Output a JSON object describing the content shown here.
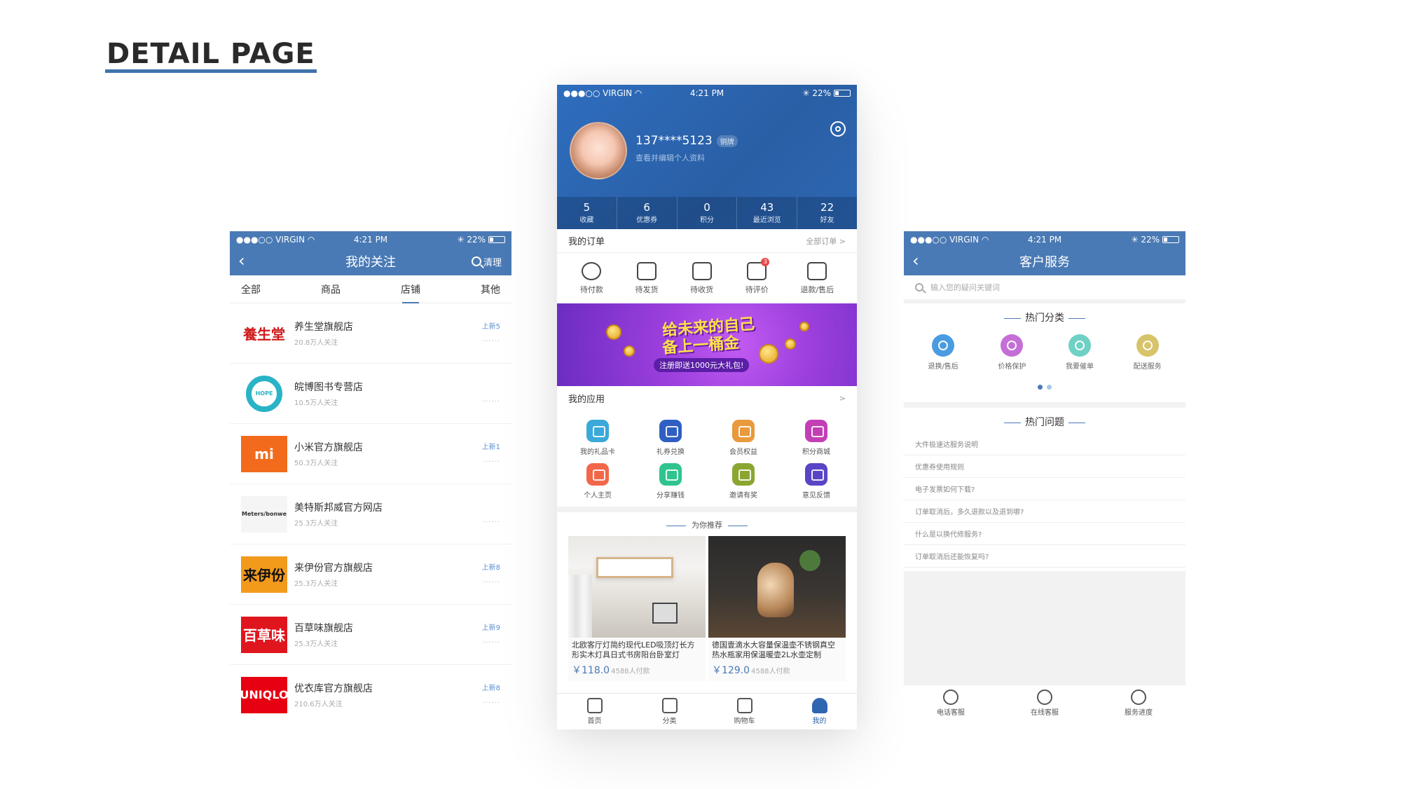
{
  "page_title": "DETAIL PAGE",
  "status": {
    "carrier": "●●●○○ VIRGIN",
    "wifi": "◠",
    "time": "4:21 PM",
    "bt": "✳",
    "battery": "22%"
  },
  "follow": {
    "title": "我的关注",
    "right": "清理",
    "tabs": [
      "全部",
      "商品",
      "店铺",
      "其他"
    ],
    "active_tab": "店铺",
    "stores": [
      {
        "name": "养生堂旗舰店",
        "followers": "20.8万人关注",
        "new": "上新5",
        "logo_text": "養生堂",
        "logo_color": "#d0191a",
        "logo_bg": "#ffffff"
      },
      {
        "name": "皖博图书专营店",
        "followers": "10.5万人关注",
        "new": "",
        "logo_text": "HOPE",
        "logo_color": "#2ab3c6",
        "logo_bg": "#ffffff"
      },
      {
        "name": "小米官方旗舰店",
        "followers": "50.3万人关注",
        "new": "上新1",
        "logo_text": "mi",
        "logo_color": "#ffffff",
        "logo_bg": "#f26b1d"
      },
      {
        "name": "美特斯邦威官方网店",
        "followers": "25.3万人关注",
        "new": "",
        "logo_text": "Meters/bonwe",
        "logo_color": "#333333",
        "logo_bg": "#f5f5f5"
      },
      {
        "name": "来伊份官方旗舰店",
        "followers": "25.3万人关注",
        "new": "上新8",
        "logo_text": "来伊份",
        "logo_color": "#111111",
        "logo_bg": "#f29a1c"
      },
      {
        "name": "百草味旗舰店",
        "followers": "25.3万人关注",
        "new": "上新9",
        "logo_text": "百草味",
        "logo_color": "#ffffff",
        "logo_bg": "#e0161e"
      },
      {
        "name": "优衣库官方旗舰店",
        "followers": "210.6万人关注",
        "new": "上新8",
        "logo_text": "UNIQLO",
        "logo_color": "#ffffff",
        "logo_bg": "#e60012"
      }
    ],
    "dots": "......"
  },
  "profile": {
    "phone": "137****5123",
    "level": "铜牌",
    "edit_hint": "查看并编辑个人资料",
    "stats": [
      {
        "num": "5",
        "label": "收藏"
      },
      {
        "num": "6",
        "label": "优惠券"
      },
      {
        "num": "0",
        "label": "积分"
      },
      {
        "num": "43",
        "label": "最近浏览"
      },
      {
        "num": "22",
        "label": "好友"
      }
    ],
    "orders_title": "我的订单",
    "orders_more": "全部订单 >",
    "orders": [
      "待付款",
      "待发货",
      "待收货",
      "待评价",
      "退款/售后"
    ],
    "orders_badge": "3",
    "banner": {
      "line1": "给未来的自己",
      "line2": "备上一桶金",
      "line3": "注册即送1000元大礼包!"
    },
    "apps_title": "我的应用",
    "apps_more": ">",
    "apps": [
      {
        "label": "我的礼品卡",
        "color": "#3aa9d9"
      },
      {
        "label": "礼券兑换",
        "color": "#2f5fc4"
      },
      {
        "label": "会员权益",
        "color": "#e89a3c"
      },
      {
        "label": "积分商城",
        "color": "#c33fb5"
      },
      {
        "label": "个人主页",
        "color": "#f2674a"
      },
      {
        "label": "分享赚钱",
        "color": "#2fc48e"
      },
      {
        "label": "邀请有奖",
        "color": "#8aa631"
      },
      {
        "label": "意见反馈",
        "color": "#5b45c6"
      }
    ],
    "rec_title": "为你推荐",
    "products": [
      {
        "title": "北欧客厅灯简约现代LED吸顶灯长方形实木灯具日式书房阳台卧室灯",
        "price": "￥118.0",
        "paid": "4588人付款"
      },
      {
        "title": "德国壹滴水大容量保温壶不锈钢真空热水瓶家用保温暖壶2L水壶定制",
        "price": "￥129.0",
        "paid": "4588人付款"
      }
    ],
    "tabbar": [
      "首页",
      "分类",
      "购物车",
      "我的"
    ],
    "active_tab": "我的"
  },
  "service": {
    "title": "客户服务",
    "search_placeholder": "输入您的疑问关键词",
    "hot_cats_title": "热门分类",
    "cats": [
      {
        "label": "退换/售后",
        "color": "#4a9be0"
      },
      {
        "label": "价格保护",
        "color": "#c46fd6"
      },
      {
        "label": "我要催单",
        "color": "#6fd0c4"
      },
      {
        "label": "配送服务",
        "color": "#d7c46a"
      }
    ],
    "hot_q_title": "热门问题",
    "questions": [
      "大件极速达服务说明",
      "优惠券使用规则",
      "电子发票如何下载?",
      "订单取消后，多久退款以及退到哪?",
      "什么是以换代修服务?",
      "订单取消后还能恢复吗?"
    ],
    "tabbar": [
      "电话客服",
      "在线客服",
      "服务进度"
    ]
  }
}
